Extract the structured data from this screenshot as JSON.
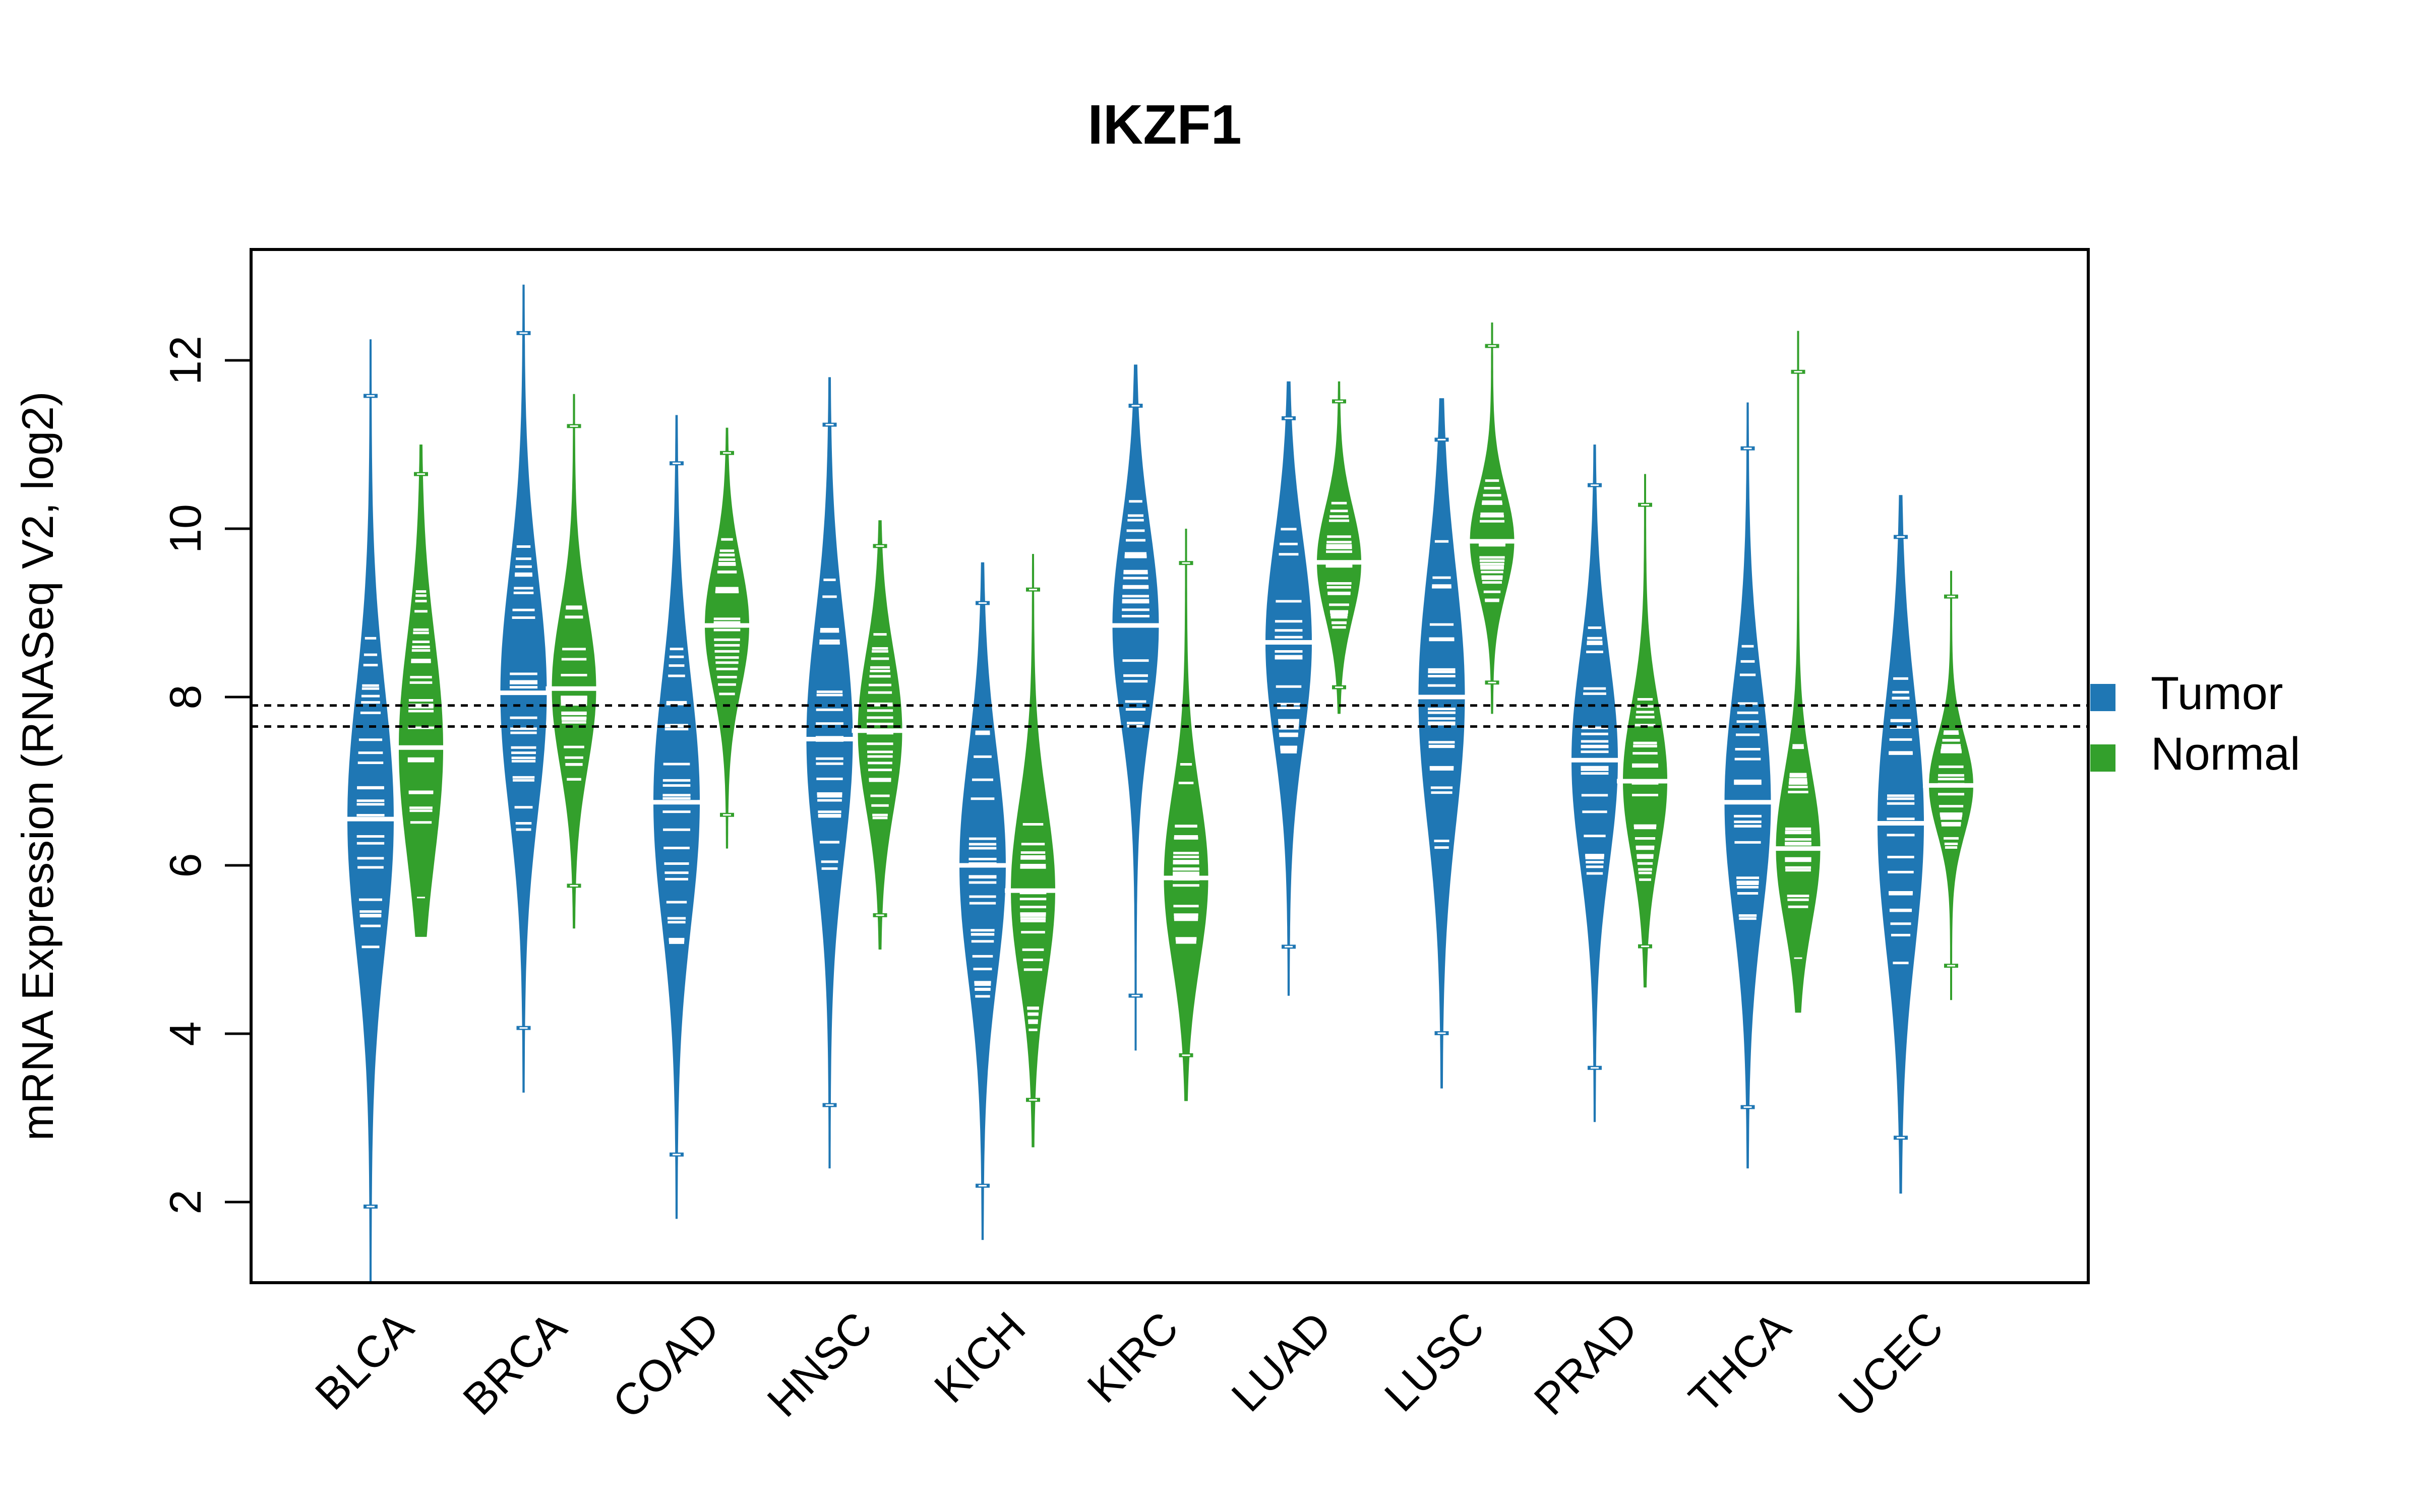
{
  "chart_data": {
    "type": "violin-beanplot",
    "title": "IKZF1",
    "xlabel": "",
    "ylabel": "mRNA Expression (RNASeq V2, log2)",
    "ylim": [
      1.1,
      13.3
    ],
    "yticks": [
      2,
      4,
      6,
      8,
      10,
      12
    ],
    "grid": false,
    "legend": {
      "position": "right",
      "entries": [
        {
          "name": "Tumor",
          "color": "#1f77b4"
        },
        {
          "name": "Normal",
          "color": "#33a02c"
        }
      ]
    },
    "reference_lines": [
      7.9,
      7.65
    ],
    "categories": [
      "BLCA",
      "BRCA",
      "COAD",
      "HNSC",
      "KICH",
      "KIRC",
      "LUAD",
      "LUSC",
      "PRAD",
      "THCA",
      "UCEC"
    ],
    "series": [
      {
        "name": "Tumor",
        "color": "#1f77b4",
        "groups": [
          {
            "median": 6.55,
            "min": 1.05,
            "max": 12.25,
            "q_low": 5.0,
            "q_high": 8.8
          },
          {
            "median": 8.05,
            "min": 3.3,
            "max": 12.9,
            "q_low": 6.3,
            "q_high": 9.8
          },
          {
            "median": 6.75,
            "min": 1.8,
            "max": 11.35,
            "q_low": 5.0,
            "q_high": 8.6
          },
          {
            "median": 7.5,
            "min": 2.4,
            "max": 11.8,
            "q_low": 5.9,
            "q_high": 9.4
          },
          {
            "median": 6.0,
            "min": 1.55,
            "max": 9.6,
            "q_low": 4.3,
            "q_high": 7.6
          },
          {
            "median": 8.85,
            "min": 3.8,
            "max": 11.95,
            "q_low": 7.5,
            "q_high": 10.4
          },
          {
            "median": 8.65,
            "min": 4.45,
            "max": 11.75,
            "q_low": 7.2,
            "q_high": 10.2
          },
          {
            "median": 8.0,
            "min": 3.35,
            "max": 11.55,
            "q_low": 6.2,
            "q_high": 9.9
          },
          {
            "median": 7.25,
            "min": 2.95,
            "max": 11.0,
            "q_low": 5.8,
            "q_high": 8.9
          },
          {
            "median": 6.75,
            "min": 2.4,
            "max": 11.5,
            "q_low": 5.3,
            "q_high": 8.7
          },
          {
            "median": 6.5,
            "min": 2.1,
            "max": 10.4,
            "q_low": 4.6,
            "q_high": 8.3
          }
        ]
      },
      {
        "name": "Normal",
        "color": "#33a02c",
        "groups": [
          {
            "median": 7.4,
            "min": 5.15,
            "max": 11.0,
            "q_low": 6.4,
            "q_high": 9.6
          },
          {
            "median": 8.1,
            "min": 5.25,
            "max": 11.6,
            "q_low": 7.0,
            "q_high": 9.3
          },
          {
            "median": 8.85,
            "min": 6.2,
            "max": 11.2,
            "q_low": 8.0,
            "q_high": 9.9
          },
          {
            "median": 7.6,
            "min": 5.0,
            "max": 10.1,
            "q_low": 6.5,
            "q_high": 8.8
          },
          {
            "median": 5.7,
            "min": 2.65,
            "max": 9.7,
            "q_low": 4.0,
            "q_high": 6.6
          },
          {
            "median": 5.85,
            "min": 3.2,
            "max": 10.0,
            "q_low": 4.8,
            "q_high": 7.3
          },
          {
            "median": 9.6,
            "min": 7.8,
            "max": 11.75,
            "q_low": 8.8,
            "q_high": 10.4
          },
          {
            "median": 9.85,
            "min": 7.8,
            "max": 12.45,
            "q_low": 9.1,
            "q_high": 10.6
          },
          {
            "median": 7.0,
            "min": 4.55,
            "max": 10.65,
            "q_low": 5.8,
            "q_high": 8.0
          },
          {
            "median": 6.2,
            "min": 4.25,
            "max": 12.35,
            "q_low": 5.3,
            "q_high": 7.5
          },
          {
            "median": 6.95,
            "min": 4.4,
            "max": 9.5,
            "q_low": 6.2,
            "q_high": 7.6
          }
        ]
      }
    ]
  }
}
